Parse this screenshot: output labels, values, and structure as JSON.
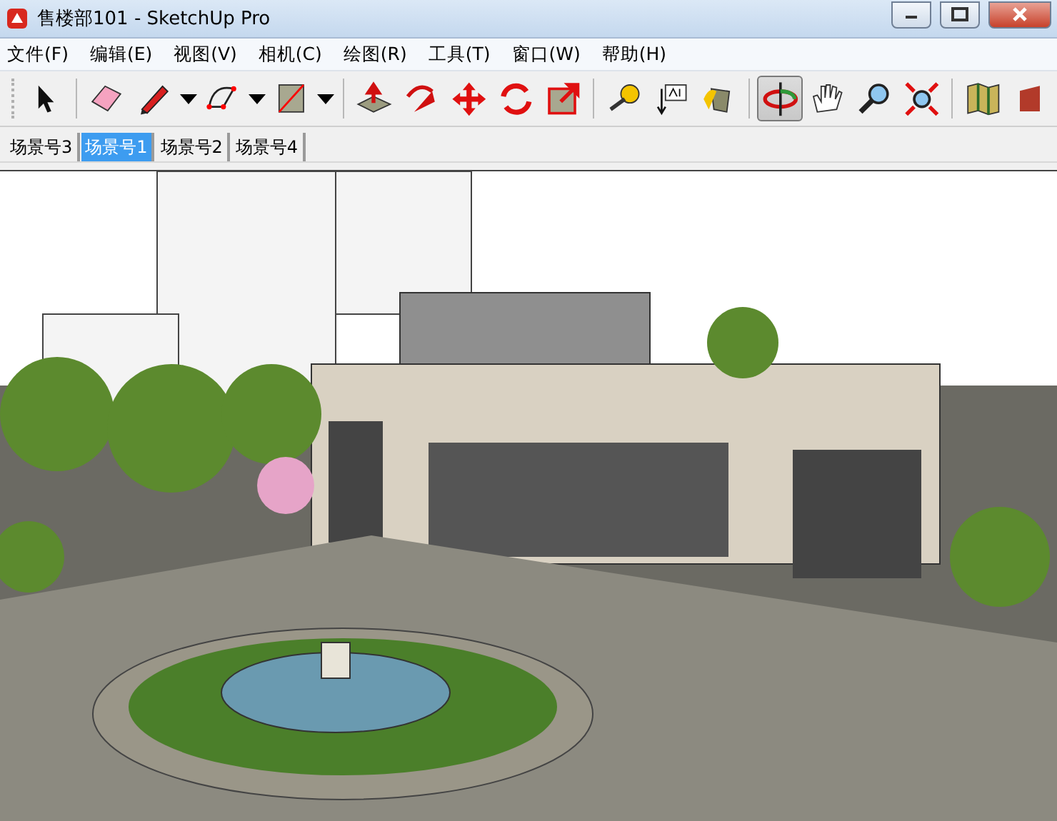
{
  "window": {
    "title": "售楼部101 - SketchUp Pro"
  },
  "menu": [
    "文件(F)",
    "编辑(E)",
    "视图(V)",
    "相机(C)",
    "绘图(R)",
    "工具(T)",
    "窗口(W)",
    "帮助(H)"
  ],
  "toolbar": {
    "groups": [
      [
        {
          "kind": "plain",
          "selected": false
        }
      ],
      [
        {
          "kind": "plain",
          "selected": false
        },
        {
          "kind": "split",
          "selected": false
        },
        {
          "kind": "split",
          "selected": false
        },
        {
          "kind": "split",
          "selected": false
        }
      ],
      [
        {
          "kind": "plain",
          "selected": false
        },
        {
          "kind": "plain",
          "selected": false
        },
        {
          "kind": "plain",
          "selected": false
        },
        {
          "kind": "plain",
          "selected": false
        },
        {
          "kind": "plain",
          "selected": false
        }
      ],
      [
        {
          "kind": "plain",
          "selected": false
        },
        {
          "kind": "plain",
          "selected": false
        },
        {
          "kind": "plain",
          "selected": false
        }
      ],
      [
        {
          "kind": "plain",
          "selected": true
        },
        {
          "kind": "plain",
          "selected": false
        },
        {
          "kind": "plain",
          "selected": false
        },
        {
          "kind": "plain",
          "selected": false
        }
      ],
      [
        {
          "kind": "plain",
          "selected": false
        },
        {
          "kind": "plain",
          "selected": false
        }
      ]
    ]
  },
  "scene_tabs": [
    {
      "label": "场景号3",
      "selected": false
    },
    {
      "label": "场景号1",
      "selected": true
    },
    {
      "label": "场景号2",
      "selected": false
    },
    {
      "label": "场景号4",
      "selected": false
    }
  ]
}
